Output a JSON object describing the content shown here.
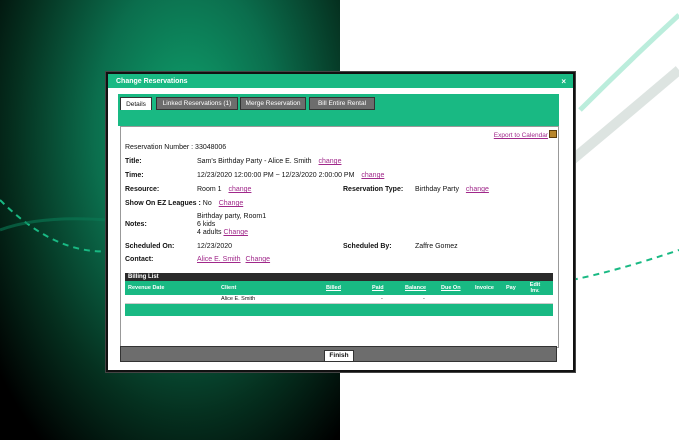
{
  "dialog": {
    "title": "Change Reservations",
    "close": "×"
  },
  "tabs": [
    {
      "label": "Details"
    },
    {
      "label": "Linked Reservations (1)"
    },
    {
      "label": "Merge Reservation"
    },
    {
      "label": "Bill Entire Rental"
    }
  ],
  "export_label": "Export to Calendar",
  "details": {
    "reservation_number_label": "Reservation Number :",
    "reservation_number": "33048006",
    "title_label": "Title:",
    "title_value": "Sam's Birthday Party - Alice E. Smith",
    "time_label": "Time:",
    "time_value": "12/23/2020 12:00:00 PM ~ 12/23/2020 2:00:00 PM",
    "resource_label": "Resource:",
    "resource_value": "Room 1",
    "reservation_type_label": "Reservation Type:",
    "reservation_type_value": "Birthday Party",
    "ez_leagues_label": "Show On EZ Leagues :",
    "ez_leagues_value": "No",
    "notes_label": "Notes:",
    "notes_line1": "Birthday party, Room1",
    "notes_line2": "6 kids",
    "notes_line3": "4 adults",
    "scheduled_on_label": "Scheduled On:",
    "scheduled_on_value": "12/23/2020",
    "scheduled_by_label": "Scheduled By:",
    "scheduled_by_value": "Zaffre Gomez",
    "contact_label": "Contact:",
    "contact_value": "Alice E. Smith",
    "change_link": "change",
    "change_link_cap": "Change"
  },
  "billing": {
    "title": "Billing List",
    "columns": [
      "Revenue Date",
      "Client",
      "Billed",
      "Paid",
      "Balance",
      "Due On",
      "Invoice",
      "Pay",
      "Edit Inv."
    ],
    "rows": [
      {
        "revenue_date": "",
        "client": "Alice E. Smith",
        "billed": "",
        "paid": "-",
        "balance": "-",
        "due_on": "",
        "invoice": "",
        "pay": "",
        "edit": ""
      }
    ]
  },
  "finish_label": "Finish",
  "colors": {
    "accent": "#19b983",
    "link": "#a0288a",
    "tab_inactive": "#6d6d6d"
  }
}
